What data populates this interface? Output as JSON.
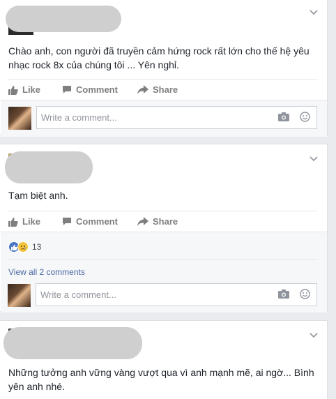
{
  "posts": [
    {
      "text": "Chào anh, con người đã truyền cảm hứng rock rất lớn cho thế hệ yêu nhạc rock 8x của chúng tôi ... Yên nghỉ.",
      "actions": {
        "like": "Like",
        "comment": "Comment",
        "share": "Share"
      },
      "comment_placeholder": "Write a comment..."
    },
    {
      "text": "Tạm biệt anh.",
      "actions": {
        "like": "Like",
        "comment": "Comment",
        "share": "Share"
      },
      "reaction_count": "13",
      "view_all": "View all 2 comments",
      "comment_placeholder": "Write a comment..."
    },
    {
      "text": "Những tưởng anh vững vàng vượt qua vì anh mạnh mẽ, ai ngờ... Bình yên anh nhé."
    }
  ],
  "colors": {
    "background": "#e9ebee",
    "action_text": "#7f7f7f",
    "link": "#4b67a1",
    "like_reaction": "#4a76c5",
    "sad_reaction": "#f5c33b"
  },
  "icons": [
    "like-icon",
    "comment-icon",
    "share-icon",
    "camera-icon",
    "smile-icon",
    "chevron-down-icon",
    "like-reaction-icon",
    "sad-reaction-icon"
  ]
}
